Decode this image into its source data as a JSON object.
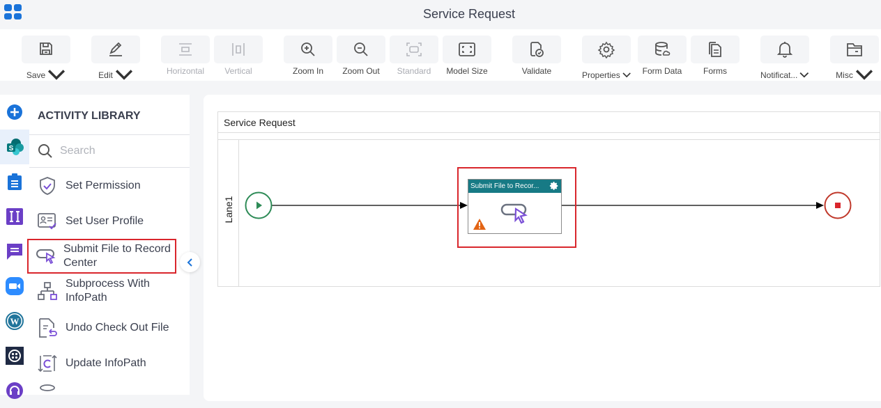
{
  "header": {
    "title": "Service Request",
    "apps_icon": "apps-grid-icon"
  },
  "toolbar": {
    "buttons": [
      {
        "label": "Save",
        "icon": "save-icon",
        "dropdown": true,
        "disabled": false
      },
      {
        "label": "Edit",
        "icon": "pencil-icon",
        "dropdown": true,
        "disabled": false
      },
      {
        "label": "Horizontal",
        "icon": "horizontal-layout-icon",
        "dropdown": false,
        "disabled": true
      },
      {
        "label": "Vertical",
        "icon": "vertical-layout-icon",
        "dropdown": false,
        "disabled": true
      },
      {
        "label": "Zoom In",
        "icon": "zoom-in-icon",
        "dropdown": false,
        "disabled": false
      },
      {
        "label": "Zoom Out",
        "icon": "zoom-out-icon",
        "dropdown": false,
        "disabled": false
      },
      {
        "label": "Standard",
        "icon": "standard-size-icon",
        "dropdown": false,
        "disabled": true
      },
      {
        "label": "Model Size",
        "icon": "model-size-icon",
        "dropdown": false,
        "disabled": false
      },
      {
        "label": "Validate",
        "icon": "validate-icon",
        "dropdown": false,
        "disabled": false
      },
      {
        "label": "Properties",
        "icon": "gear-icon",
        "dropdown": true,
        "disabled": false
      },
      {
        "label": "Form Data",
        "icon": "database-icon",
        "dropdown": false,
        "disabled": false
      },
      {
        "label": "Forms",
        "icon": "forms-icon",
        "dropdown": false,
        "disabled": false
      },
      {
        "label": "Notificat...",
        "icon": "bell-icon",
        "dropdown": true,
        "disabled": false
      },
      {
        "label": "Misc",
        "icon": "folder-icon",
        "dropdown": true,
        "disabled": false
      }
    ]
  },
  "rail": {
    "items": [
      {
        "name": "add",
        "icon": "plus-circle-icon"
      },
      {
        "name": "sharepoint",
        "icon": "sharepoint-icon",
        "active": true
      },
      {
        "name": "clipboard",
        "icon": "clipboard-icon"
      },
      {
        "name": "forms-tool",
        "icon": "text-tool-icon"
      },
      {
        "name": "chat",
        "icon": "chat-icon"
      },
      {
        "name": "zoom",
        "icon": "video-icon"
      },
      {
        "name": "wordpress",
        "icon": "wordpress-icon"
      },
      {
        "name": "twilio",
        "icon": "twilio-icon"
      },
      {
        "name": "support",
        "icon": "headset-icon"
      }
    ]
  },
  "library": {
    "title": "ACTIVITY LIBRARY",
    "search_placeholder": "Search",
    "items": [
      {
        "label": "Set Permission",
        "icon": "shield-check-icon"
      },
      {
        "label": "Set User Profile",
        "icon": "user-profile-icon"
      },
      {
        "label": "Submit File to Record Center",
        "icon": "submit-file-icon",
        "selected": true
      },
      {
        "label": "Subprocess With InfoPath",
        "icon": "subprocess-icon"
      },
      {
        "label": "Undo Check Out File",
        "icon": "undo-checkout-icon"
      },
      {
        "label": "Update InfoPath",
        "icon": "update-infopath-icon"
      }
    ]
  },
  "canvas": {
    "pool_title": "Service Request",
    "lane_label": "Lane1",
    "task": {
      "title": "Submit File to Recor...",
      "warning": true
    },
    "colors": {
      "start": "#2e8b57",
      "end": "#c0392b",
      "task_header": "#177a85",
      "selection": "#d9262c"
    }
  }
}
